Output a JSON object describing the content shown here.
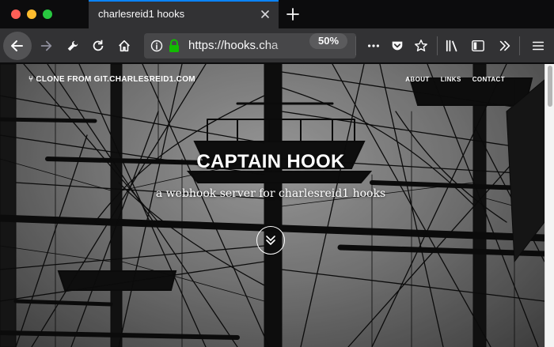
{
  "browser": {
    "tab": {
      "title": "charlesreid1 hooks"
    },
    "url": "https://hooks.cha",
    "zoom": "50%"
  },
  "site": {
    "brand": "⑂ CLONE FROM GIT.CHARLESREID1.COM",
    "nav": [
      {
        "label": "ABOUT"
      },
      {
        "label": "LINKS"
      },
      {
        "label": "CONTACT"
      }
    ]
  },
  "hero": {
    "title": "CAPTAIN HOOK",
    "subtitle": "a webhook server for charlesreid1 hooks"
  },
  "colors": {
    "accent": "#0a84ff",
    "toolbar": "#323234",
    "tab_strip": "#0c0c0d",
    "lock": "#12bc00"
  }
}
